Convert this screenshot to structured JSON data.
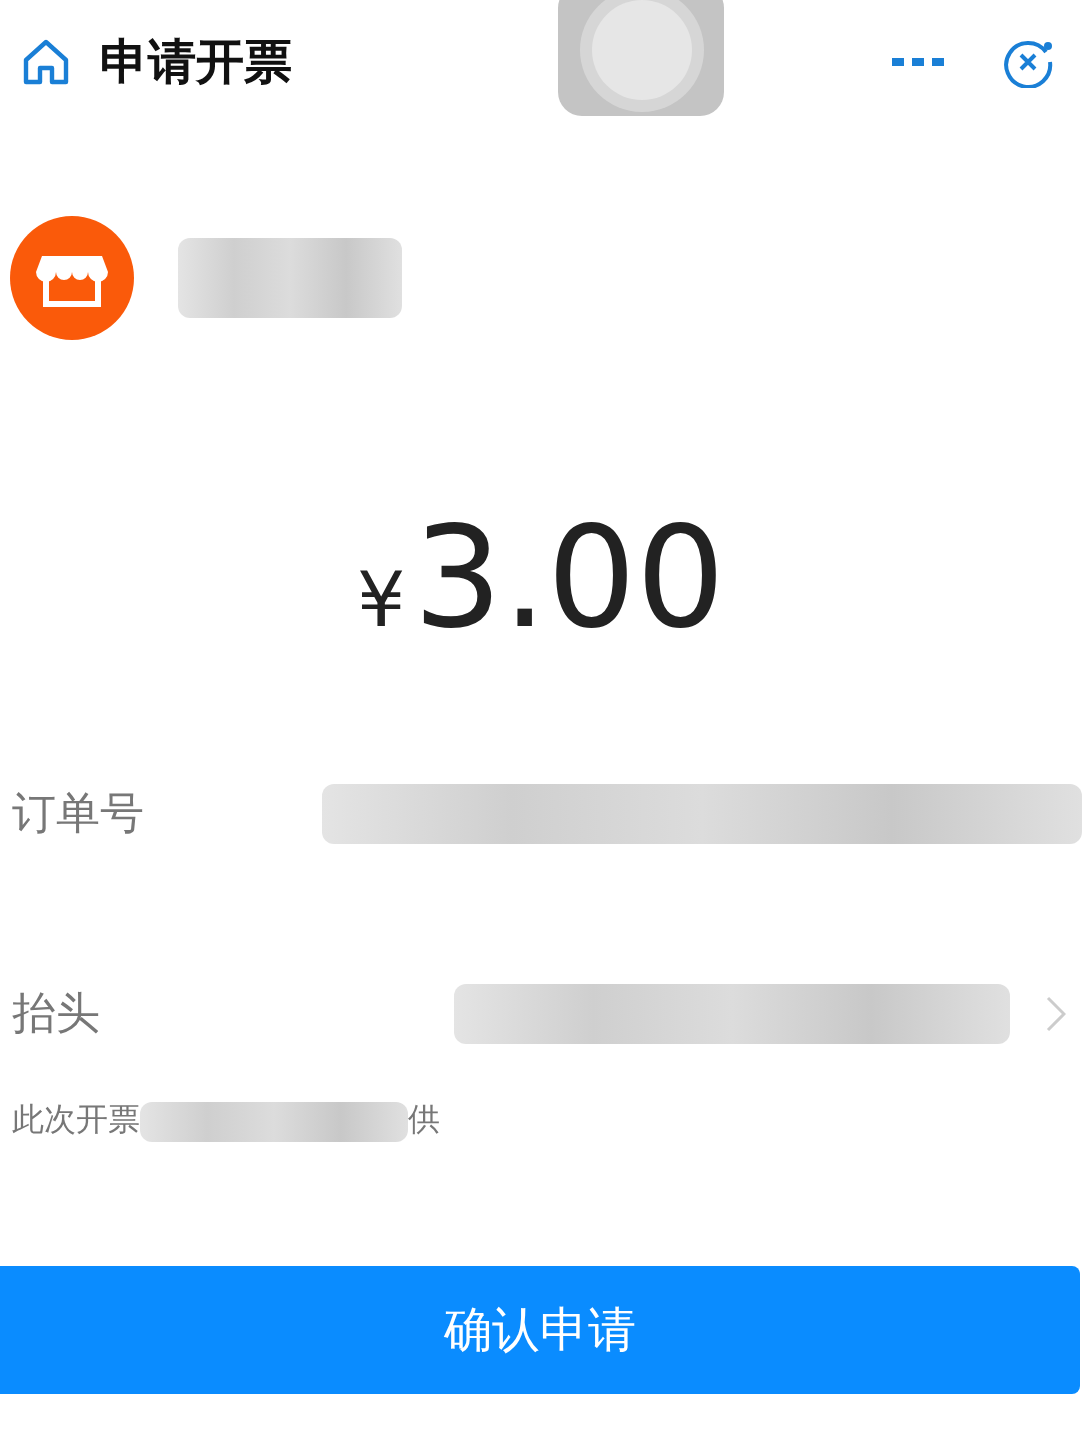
{
  "header": {
    "title": "申请开票"
  },
  "amount": {
    "currency": "¥",
    "value": "3.00"
  },
  "fields": [
    {
      "label": "订单号",
      "kind": "plain"
    },
    {
      "label": "抬头",
      "kind": "link"
    }
  ],
  "note": {
    "before": "此次开票",
    "after": "供"
  },
  "submit": {
    "label": "确认申请"
  }
}
